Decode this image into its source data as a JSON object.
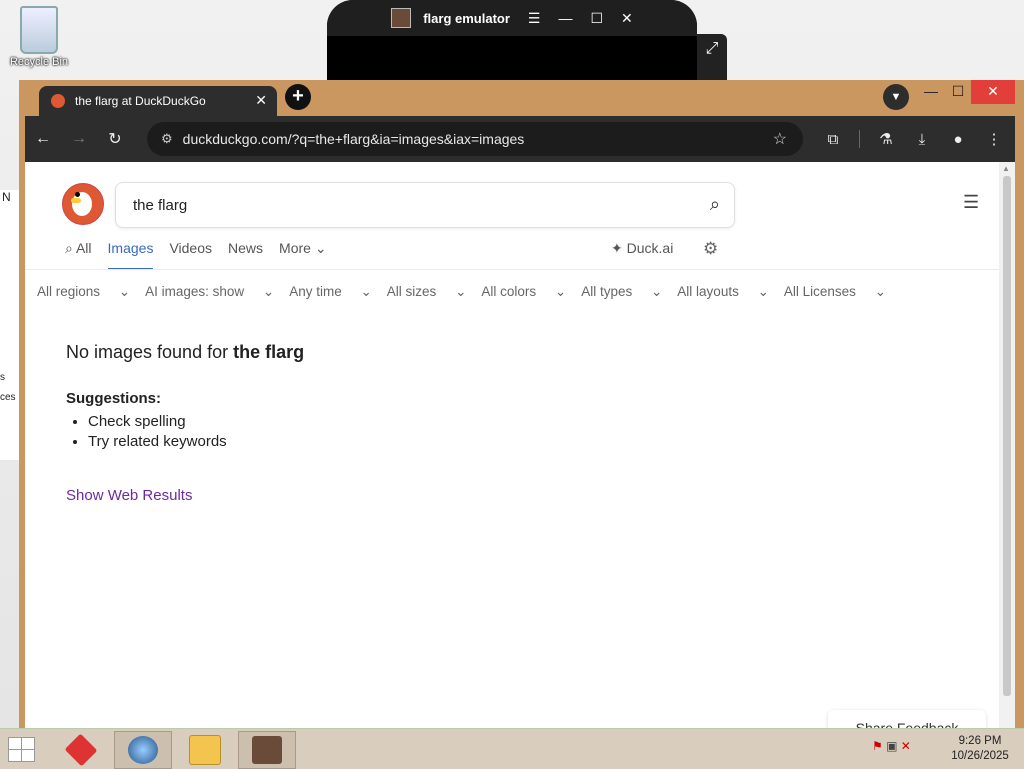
{
  "desktop": {
    "recycle_bin_label": "Recycle Bin",
    "left_fragments": [
      "N",
      "s",
      "ces"
    ]
  },
  "emulator": {
    "title": "flarg emulator",
    "menu_icon": "hamburger-icon",
    "controls": [
      "minimize",
      "maximize",
      "close"
    ]
  },
  "browser": {
    "tab_title": "the flarg at DuckDuckGo",
    "url": "duckduckgo.com/?q=the+flarg&ia=images&iax=images",
    "accent": "#de5833"
  },
  "ddg": {
    "search_value": "the flarg",
    "nav": {
      "all": "All",
      "images": "Images",
      "videos": "Videos",
      "news": "News",
      "more": "More",
      "duckai": "Duck.ai"
    },
    "filters": [
      "All regions",
      "AI images: show",
      "Any time",
      "All sizes",
      "All colors",
      "All types",
      "All layouts",
      "All Licenses"
    ],
    "no_results_prefix": "No images found for",
    "no_results_query": "the flarg",
    "suggestions_title": "Suggestions:",
    "suggestions": [
      "Check spelling",
      "Try related keywords"
    ],
    "web_results_link": "Show Web Results",
    "feedback": "Share Feedback",
    "link_color": "#6d2a9e",
    "active_tab_color": "#3969c1"
  },
  "taskbar": {
    "time": "9:26 PM",
    "date": "10/26/2025"
  }
}
